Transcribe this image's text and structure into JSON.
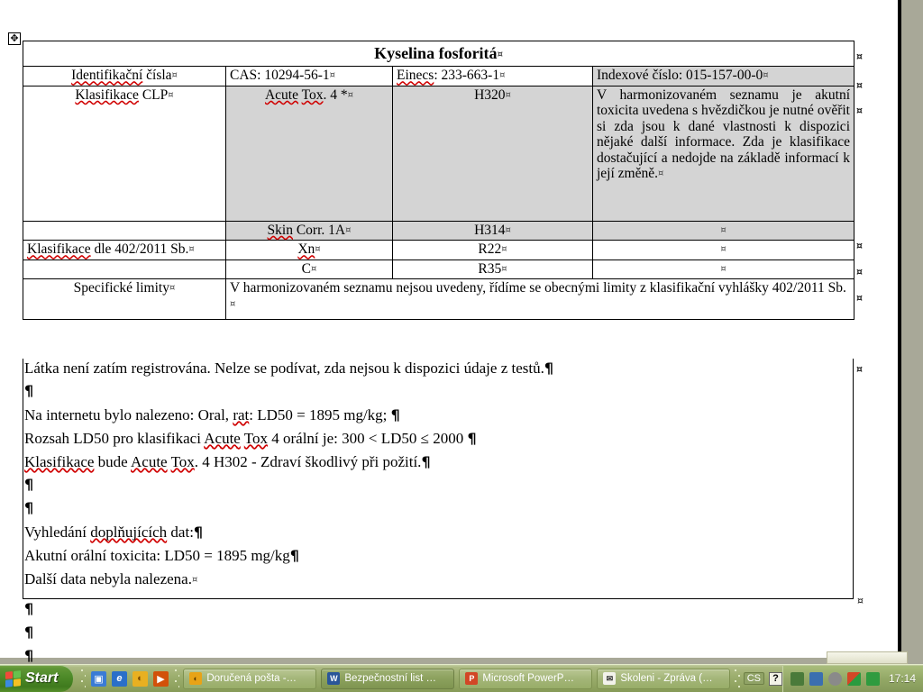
{
  "document": {
    "title_row": {
      "text": "Kyselina fosforitá",
      "marker": "¤"
    },
    "table": {
      "rows": [
        {
          "label": "Identifikační čísla¤",
          "c2": "CAS: 10294-56-1¤",
          "c3": "Einecs: 233-663-1¤",
          "c4": "Indexové číslo: 015-157-00-0¤"
        },
        {
          "label": "Klasifikace CLP¤",
          "c2": "Acute Tox. 4 *¤",
          "c3": "H320¤",
          "c4": "V harmonizovaném seznamu je akutní toxicita uvedena s hvězdičkou je nutné ověřit si zda jsou k dané vlastnosti k dispozici nějaké další informace. Zda je klasifikace dostačující a nedojde na základě informací k její změně.¤"
        },
        {
          "label": "",
          "c2": "Skin Corr. 1A¤",
          "c3": "H314¤",
          "c4": "¤"
        },
        {
          "label": "Klasifikace dle 402/2011 Sb.¤",
          "c2": "Xn¤",
          "c3": "R22¤",
          "c4": "¤"
        },
        {
          "label": "",
          "c2": "C¤",
          "c3": "R35¤",
          "c4": "¤"
        },
        {
          "label": "Specifické limity¤",
          "c2": "V harmonizovaném seznamu nejsou uvedeny, řídíme se obecnými limity z klasifikační vyhlášky 402/2011 Sb.¤",
          "c3": "",
          "c4": ""
        }
      ]
    },
    "body_paragraphs": [
      "Látka není zatím registrována. Nelze se podívat, zda nejsou k dispozici údaje z testů.¶",
      "¶",
      "Na internetu bylo nalezeno:   Oral, rat: LD50 = 1895 mg/kg; ¶",
      "Rozsah LD50 pro klasifikaci Acute Tox 4 orální je: 300  <  LD50 ≤  2000 ¶",
      "Klasifikace bude Acute Tox. 4  H302  - Zdraví škodlivý při požití.¶",
      "¶",
      "¶",
      "Vyhledání doplňujících dat:¶",
      "Akutní orální toxicita: LD50 = 1895 mg/kg¶",
      "Další data nebyla nalezena.¤"
    ],
    "trailing_marks": [
      "¶",
      "¶",
      "¶"
    ],
    "row_end_marks": [
      "¤",
      "¤",
      "¤",
      "¤",
      "¤",
      "¤",
      "¤"
    ],
    "page_end_mark": "¤"
  },
  "taskbar": {
    "start_label": "Start",
    "quick_launch": [
      {
        "name": "show-desktop-icon",
        "glyph": "▣",
        "color": "#3a7bd5"
      },
      {
        "name": "internet-explorer-icon",
        "glyph": "e",
        "color": "#2a6fc9"
      },
      {
        "name": "outlook-today-icon",
        "glyph": "◐",
        "color": "#e8b021"
      },
      {
        "name": "media-player-icon",
        "glyph": "▶",
        "color": "#d2510a"
      }
    ],
    "tasks": [
      {
        "label": "Doručená pošta -…",
        "icon": "outlook-icon",
        "icon_glyph": "◐",
        "icon_color": "#e8a317",
        "active": false
      },
      {
        "label": "Bezpečnostní list …",
        "icon": "word-icon",
        "icon_glyph": "W",
        "icon_color": "#2a5699",
        "active": true
      },
      {
        "label": "Microsoft PowerP…",
        "icon": "powerpoint-icon",
        "icon_glyph": "P",
        "icon_color": "#d24726",
        "active": false
      },
      {
        "label": "Skoleni - Zpráva (…",
        "icon": "mail-icon",
        "icon_glyph": "✉",
        "icon_color": "#ffffff",
        "active": false
      }
    ],
    "language": "CS",
    "help_glyph": "?",
    "tray_icons": [
      {
        "name": "safely-remove-hardware-icon",
        "color": "#4a7a3a"
      },
      {
        "name": "network-connection-icon",
        "color": "#3b6fb0"
      },
      {
        "name": "antivirus-shield-icon",
        "color": "#7a7a7a"
      },
      {
        "name": "office-shortcut-bar-icon",
        "color": "#d24726"
      },
      {
        "name": "notes-icon",
        "color": "#2f9b3f"
      }
    ],
    "clock": "17:14"
  },
  "colors": {
    "page_background": "#ffffff",
    "workspace_background": "#a8a898",
    "shaded_cell": "#d4d4d4",
    "spellcheck_underline": "#d00000",
    "taskbar_green": "#91a461",
    "start_green": "#4d8a28"
  }
}
